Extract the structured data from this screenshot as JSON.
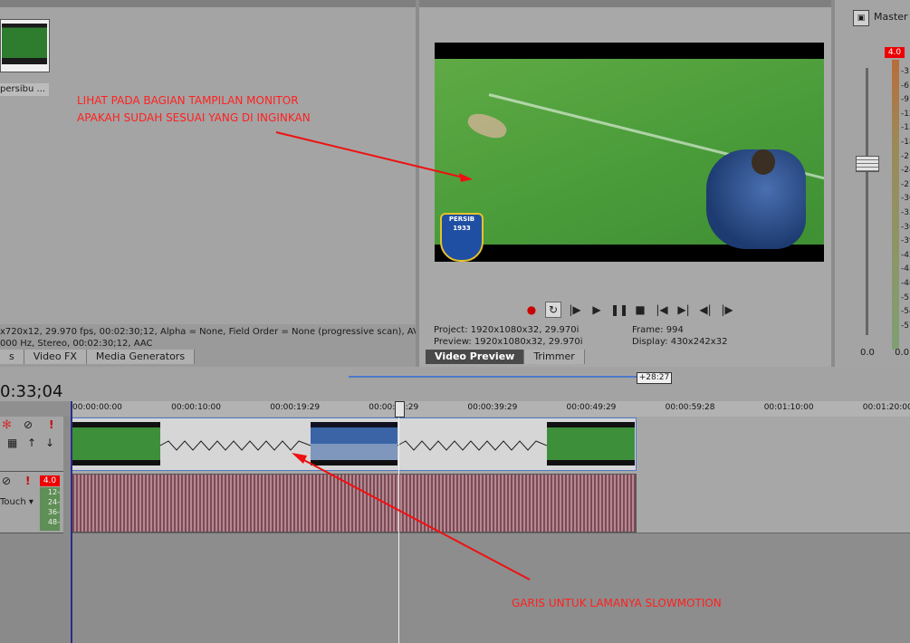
{
  "media_panel": {
    "thumb_label": "persibu ...",
    "info_line1": "x720x12, 29.970 fps, 00:02:30;12, Alpha = None, Field Order = None (progressive scan), AV",
    "info_line2": "000 Hz, Stereo, 00:02:30;12, AAC",
    "tabs": [
      "s",
      "Video FX",
      "Media Generators"
    ]
  },
  "preview_panel": {
    "logo_text": "PERSIB 1933",
    "project_label": "Project:",
    "project_value": "1920x1080x32, 29.970i",
    "preview_label": "Preview:",
    "preview_value": "1920x1080x32, 29.970i",
    "frame_label": "Frame:",
    "frame_value": "994",
    "display_label": "Display:",
    "display_value": "430x242x32",
    "tabs": [
      "Video Preview",
      "Trimmer"
    ]
  },
  "mixer": {
    "title": "Master",
    "level_badge": "4.0",
    "scale": [
      "3",
      "6",
      "9",
      "12",
      "15",
      "18",
      "21",
      "24",
      "27",
      "30",
      "33",
      "36",
      "39",
      "42",
      "45",
      "48",
      "51",
      "54",
      "57"
    ],
    "footer_left": "0.0",
    "footer_right": "0.0"
  },
  "timeline": {
    "timecode": "0:33;04",
    "nav_label": "+28:27",
    "ruler": [
      "00:00:00:00",
      "00:00:10:00",
      "00:00:19:29",
      "00:00:29:29",
      "00:00:39:29",
      "00:00:49:29",
      "00:00:59:28",
      "00:01:10:00",
      "00:01:20:00"
    ],
    "audio_level": "4.0",
    "audio_scale": [
      "12-",
      "24-",
      "36-",
      "48-"
    ],
    "touch_label": "Touch"
  },
  "annotations": {
    "monitor_note": "LIHAT PADA BAGIAN TAMPILAN MONITOR\nAPAKAH SUDAH SESUAI YANG DI INGINKAN",
    "slowmotion_note": "GARIS UNTUK LAMANYA SLOWMOTION"
  },
  "colors": {
    "annotation": "#ff2020",
    "clip_border": "#4f79c9",
    "badge": "#e00000"
  }
}
